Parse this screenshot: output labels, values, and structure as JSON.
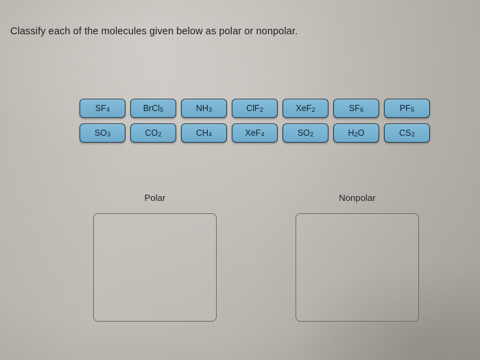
{
  "prompt": {
    "text": "Classify each of the molecules given below as polar or nonpolar."
  },
  "tiles": {
    "rows": [
      [
        {
          "formula": "SF4",
          "base": "SF",
          "sub": "4"
        },
        {
          "formula": "BrCl5",
          "base": "BrCl",
          "sub": "5"
        },
        {
          "formula": "NH3",
          "base": "NH",
          "sub": "3"
        },
        {
          "formula": "ClF2",
          "base": "ClF",
          "sub": "2"
        },
        {
          "formula": "XeF2",
          "base": "XeF",
          "sub": "2"
        },
        {
          "formula": "SF6",
          "base": "SF",
          "sub": "6"
        },
        {
          "formula": "PF5",
          "base": "PF",
          "sub": "5"
        }
      ],
      [
        {
          "formula": "SO3",
          "base": "SO",
          "sub": "3"
        },
        {
          "formula": "CO2",
          "base": "CO",
          "sub": "2"
        },
        {
          "formula": "CH4",
          "base": "CH",
          "sub": "4"
        },
        {
          "formula": "XeF4",
          "base": "XeF",
          "sub": "4"
        },
        {
          "formula": "SO2",
          "base": "SO",
          "sub": "2"
        },
        {
          "formula": "H2O",
          "base": "H",
          "sub": "2",
          "tail": "O"
        },
        {
          "formula": "CS2",
          "base": "CS",
          "sub": "2"
        }
      ]
    ]
  },
  "zones": [
    {
      "id": "polar",
      "label": "Polar",
      "items": []
    },
    {
      "id": "nonpolar",
      "label": "Nonpolar",
      "items": []
    }
  ],
  "colors": {
    "tile_fill": "#7ab4d3",
    "tile_border": "#22384a",
    "tile_text": "#10222f",
    "background": "#b2ada6",
    "text": "#1b1b1c",
    "dropbox_border": "#6e6a64"
  }
}
